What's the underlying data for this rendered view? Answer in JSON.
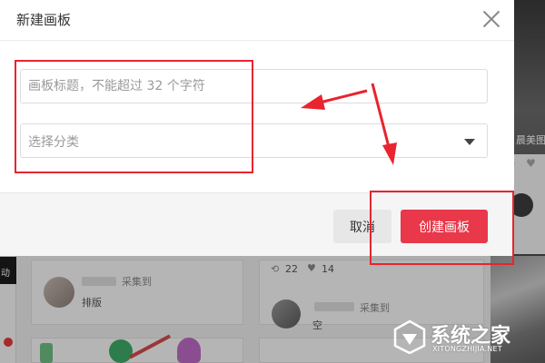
{
  "dialog": {
    "title": "新建画板",
    "title_input_placeholder": "画板标题，不能超过 32 个字符",
    "category_placeholder": "选择分类",
    "cancel_label": "取消",
    "create_label": "创建画板"
  },
  "background": {
    "left_badge": "动",
    "card1_action": "采集到",
    "card1_board": "排版",
    "card2_repins": "22",
    "card2_likes": "14",
    "card2_action": "采集到",
    "card2_board": "空",
    "right_caption": "晨美图",
    "right_count": "9"
  },
  "watermark": {
    "name": "系统之家",
    "url": "XITONGZHIJIA.NET"
  },
  "colors": {
    "accent": "#e8384a",
    "annotation": "#e8242f"
  }
}
